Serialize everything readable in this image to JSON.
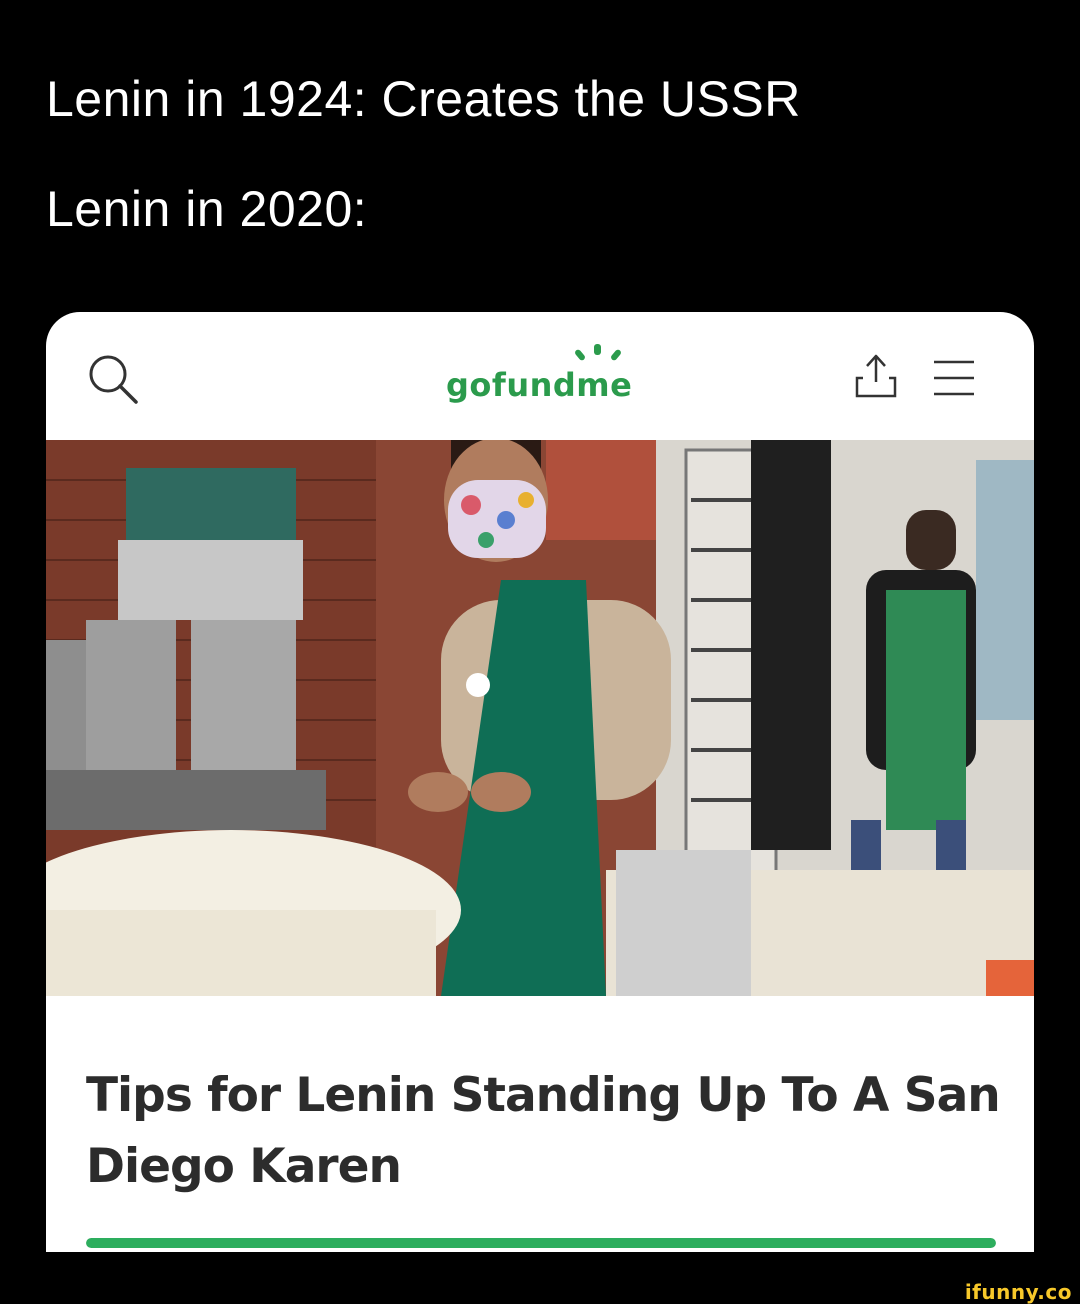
{
  "captions": {
    "line1": "Lenin in 1924: Creates the USSR",
    "line2": "Lenin in 2020:"
  },
  "app": {
    "logo_text": "gofundme",
    "icons": {
      "search": "search-icon",
      "share": "share-icon",
      "menu": "hamburger-menu-icon"
    }
  },
  "article": {
    "title": "Tips for Lenin Standing Up To A San Diego Karen",
    "progress_fraction": 1.0
  },
  "colors": {
    "brand_green": "#2b9b4c",
    "progress_green": "#2dae5e",
    "apron_green": "#0f6e55",
    "watermark_yellow": "#f7c82a"
  },
  "watermark": "ifunny.co"
}
